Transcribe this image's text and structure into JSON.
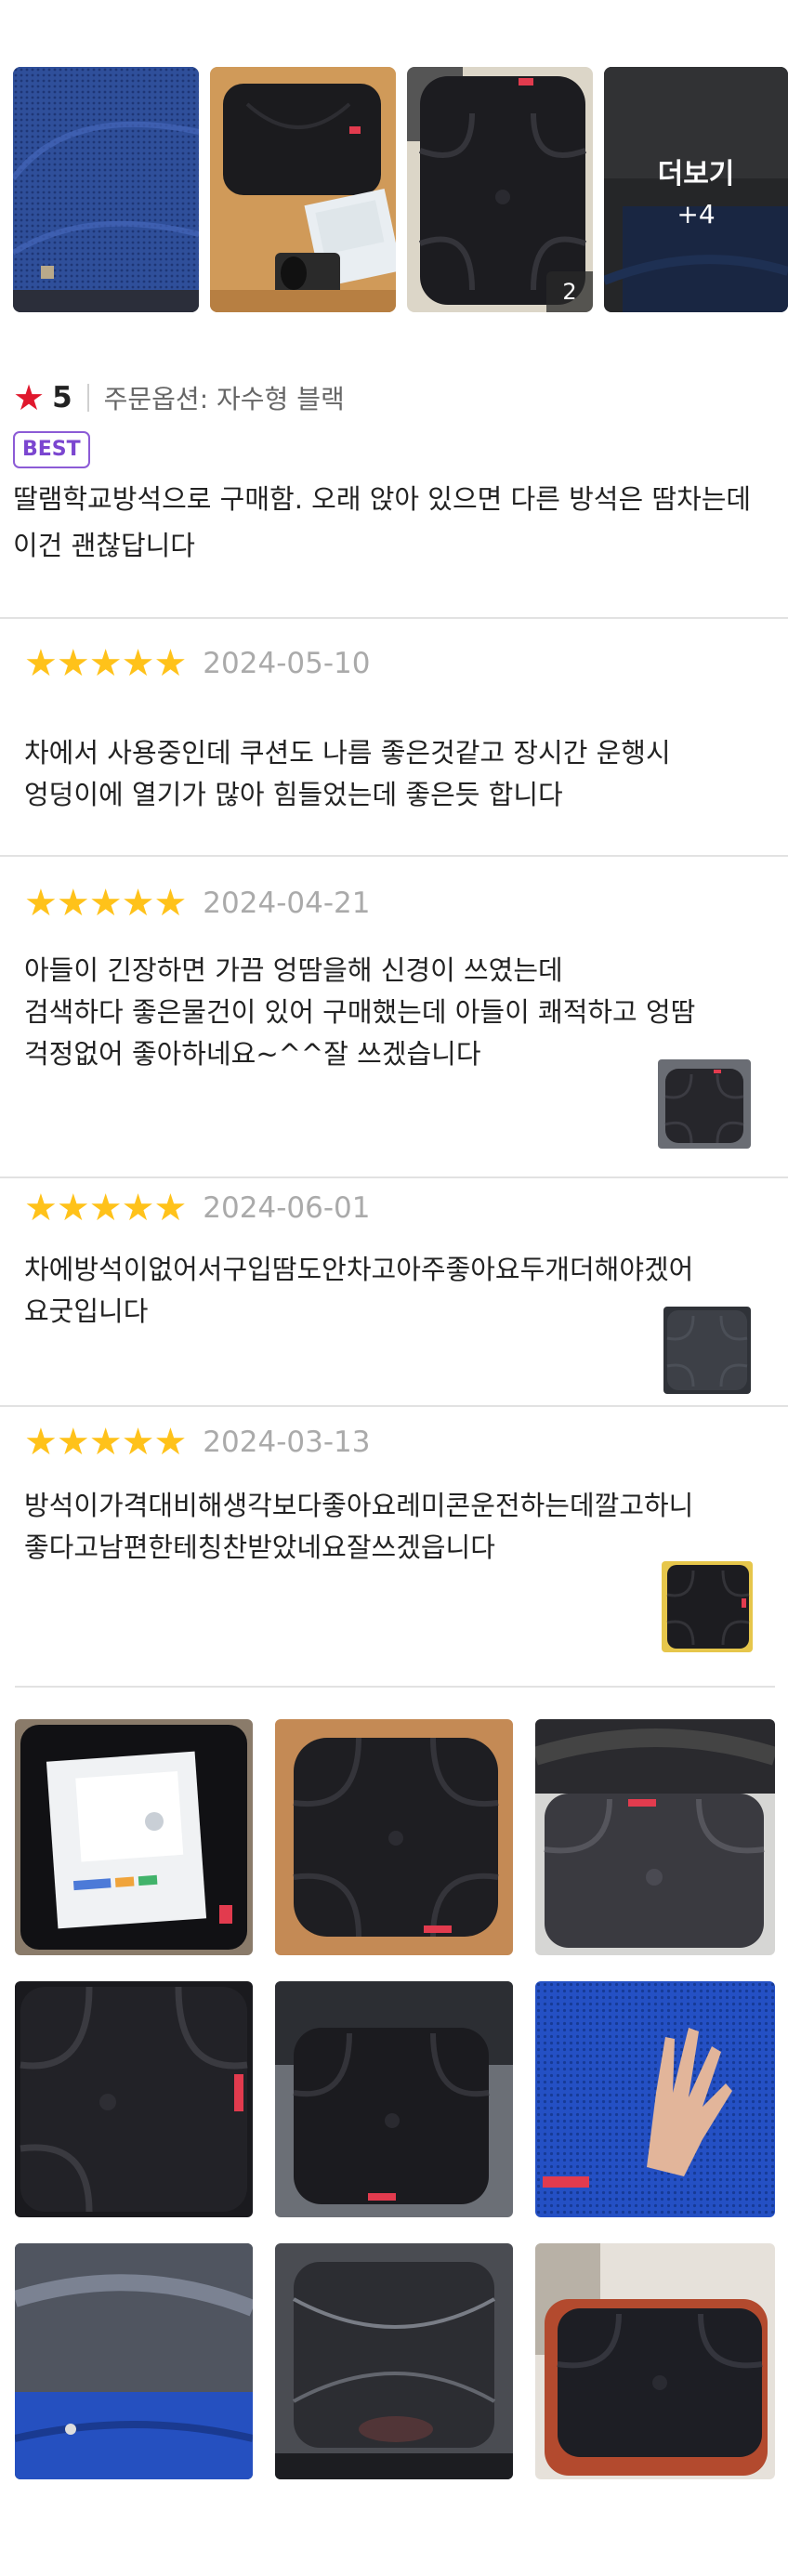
{
  "top_strip": {
    "photos": [
      {
        "name": "blue-mesh-cushion-photo"
      },
      {
        "name": "black-cushion-on-desk-photo"
      },
      {
        "name": "black-cushion-on-chair-photo",
        "count": "2"
      },
      {
        "name": "more-photos-tile"
      }
    ],
    "more_label": "더보기",
    "more_count": "+4"
  },
  "best_review": {
    "rating": "5",
    "option": "주문옵션: 자수형 블랙",
    "badge": "BEST",
    "text": "딸램학교방석으로 구매함. 오래 앉아 있으면 다른 방석은 땀차는데 이건 괜찮답니다"
  },
  "reviews": [
    {
      "stars": "★★★★★",
      "date": "2024-05-10",
      "text": "차에서 사용중인데 쿠션도 나름 좋은것같고 장시간 운행시\n엉덩이에 열기가 많아 힘들었는데 좋은듯 합니다"
    },
    {
      "stars": "★★★★★",
      "date": "2024-04-21",
      "text": "아들이 긴장하면 가끔 엉땀을해 신경이 쓰였는데\n검색하다 좋은물건이 있어 구매했는데 아들이 쾌적하고 엉땀\n걱정없어 좋아하네요~^^잘 쓰겠습니다"
    },
    {
      "stars": "★★★★★",
      "date": "2024-06-01",
      "text": "차에방석이없어서구입땀도안차고아주좋아요두개더해야겠어\n요굿입니다"
    },
    {
      "stars": "★★★★★",
      "date": "2024-03-13",
      "text": "방석이가격대비해생각보다좋아요레미콘운전하는데깔고하니\n좋다고남편한테칭찬받았네요잘쓰겠읍니다"
    }
  ],
  "colors": {
    "star_yellow": "#ffc21a",
    "star_red": "#e0182d",
    "best_purple": "#7b46d0",
    "date_gray": "#aaaaaa"
  },
  "gallery": [
    {
      "name": "gallery-photo-packaged-cushion"
    },
    {
      "name": "gallery-photo-cushion-on-wood"
    },
    {
      "name": "gallery-photo-cushion-on-chair"
    },
    {
      "name": "gallery-photo-cushion-closeup"
    },
    {
      "name": "gallery-photo-cushion-office-chair"
    },
    {
      "name": "gallery-photo-blue-mesh-hand"
    },
    {
      "name": "gallery-photo-blue-mesh-wrapped"
    },
    {
      "name": "gallery-photo-cushion-plastic"
    },
    {
      "name": "gallery-photo-cushion-red-chair"
    }
  ]
}
